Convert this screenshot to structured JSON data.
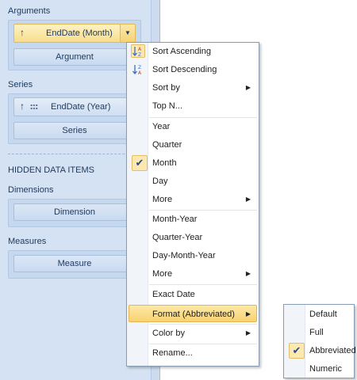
{
  "panel": {
    "arguments_label": "Arguments",
    "argument_item": "EndDate (Month)",
    "argument_slot": "Argument",
    "series_label": "Series",
    "series_item": "EndDate (Year)",
    "series_slot": "Series",
    "hidden_label": "HIDDEN DATA ITEMS",
    "dimensions_label": "Dimensions",
    "dimension_slot": "Dimension",
    "measures_label": "Measures",
    "measure_slot": "Measure"
  },
  "context_menu": {
    "sort_ascending": "Sort Ascending",
    "sort_descending": "Sort Descending",
    "sort_by": "Sort by",
    "top_n": "Top N...",
    "year": "Year",
    "quarter": "Quarter",
    "month": "Month",
    "day": "Day",
    "more_1": "More",
    "month_year": "Month-Year",
    "quarter_year": "Quarter-Year",
    "day_month_year": "Day-Month-Year",
    "more_2": "More",
    "exact_date": "Exact Date",
    "format": "Format (Abbreviated)",
    "color_by": "Color by",
    "rename": "Rename...",
    "checked": "Month"
  },
  "format_submenu": {
    "default": "Default",
    "full": "Full",
    "abbreviated": "Abbreviated",
    "numeric": "Numeric",
    "checked": "Abbreviated"
  },
  "colors": {
    "highlight": "#f8d272",
    "panel_bg": "#d5e2f3",
    "check": "#2c4a86"
  }
}
